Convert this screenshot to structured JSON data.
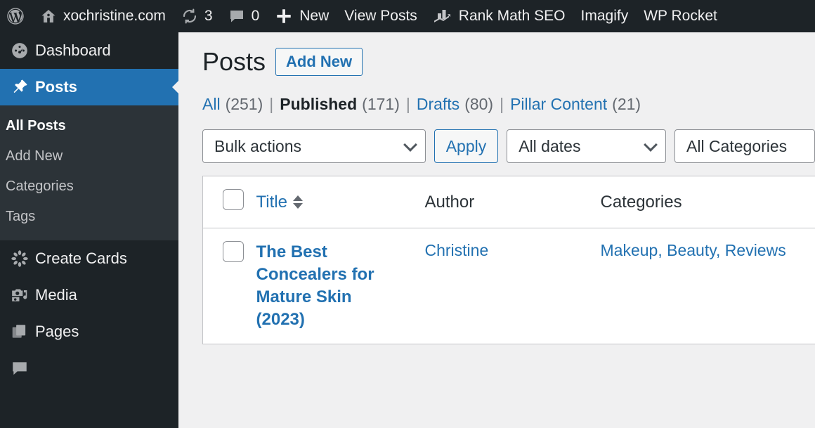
{
  "adminbar": {
    "wp_logo": "wordpress-logo",
    "site_name": "xochristine.com",
    "updates_count": "3",
    "comments_count": "0",
    "new_label": "New",
    "view_posts_label": "View Posts",
    "rank_math_label": "Rank Math SEO",
    "imagify_label": "Imagify",
    "wp_rocket_label": "WP Rocket"
  },
  "sidebar": {
    "items": [
      {
        "label": "Dashboard",
        "icon": "dashboard-gauge-icon",
        "current": false
      },
      {
        "label": "Posts",
        "icon": "pin-icon",
        "current": true
      },
      {
        "label": "Create Cards",
        "icon": "flower-sparkle-icon",
        "current": false
      },
      {
        "label": "Media",
        "icon": "media-camera-music-icon",
        "current": false
      },
      {
        "label": "Pages",
        "icon": "pages-icon",
        "current": false
      }
    ],
    "submenu": [
      {
        "label": "All Posts",
        "current": true
      },
      {
        "label": "Add New",
        "current": false
      },
      {
        "label": "Categories",
        "current": false
      },
      {
        "label": "Tags",
        "current": false
      }
    ]
  },
  "main": {
    "page_title": "Posts",
    "add_new_label": "Add New",
    "status_links": [
      {
        "label": "All",
        "count": "(251)",
        "current": false
      },
      {
        "label": "Published",
        "count": "(171)",
        "current": true
      },
      {
        "label": "Drafts",
        "count": "(80)",
        "current": false
      },
      {
        "label": "Pillar Content",
        "count": "(21)",
        "current": false
      }
    ],
    "separator": "|",
    "tablenav": {
      "bulk_actions_value": "Bulk actions",
      "apply_label": "Apply",
      "dates_value": "All dates",
      "categories_value": "All Categories"
    },
    "table": {
      "columns": {
        "title": "Title",
        "author": "Author",
        "categories": "Categories"
      },
      "rows": [
        {
          "title": "The Best Concealers for Mature Skin (2023)",
          "author": "Christine",
          "categories": [
            "Makeup",
            "Beauty",
            "Reviews"
          ],
          "category_separator": ", "
        }
      ]
    }
  },
  "colors": {
    "admin_dark": "#1d2327",
    "submenu_dark": "#2c3338",
    "accent_blue": "#2271b1",
    "content_bg": "#f0f0f1",
    "border_gray": "#c3c4c7"
  }
}
